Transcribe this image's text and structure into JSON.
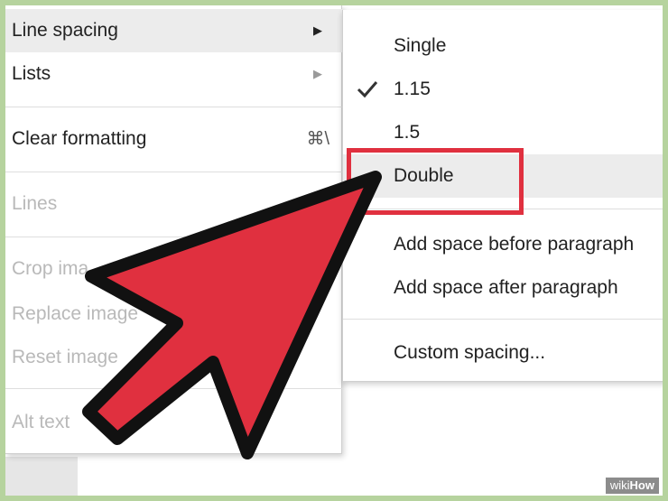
{
  "main_menu": {
    "items": [
      {
        "label": "Line spacing",
        "has_submenu": true
      },
      {
        "label": "Lists",
        "has_submenu": true
      },
      {
        "label": "Clear formatting",
        "shortcut": "⌘\\"
      },
      {
        "label": "Lines"
      },
      {
        "label": "Crop ima"
      },
      {
        "label": "Replace image"
      },
      {
        "label": "Reset image"
      },
      {
        "label": "Alt text"
      }
    ]
  },
  "submenu": {
    "items": [
      {
        "label": "Single"
      },
      {
        "label": "1.15",
        "checked": true
      },
      {
        "label": "1.5"
      },
      {
        "label": "Double",
        "highlighted": true
      },
      {
        "label": "Add space before paragraph"
      },
      {
        "label": "Add space after paragraph"
      },
      {
        "label": "Custom spacing..."
      }
    ]
  },
  "colors": {
    "highlight": "#e0303f",
    "pointer_fill": "#e0303f",
    "border": "#b6d39e"
  },
  "watermark": {
    "part1": "wiki",
    "part2": "How"
  },
  "icons": {
    "submenu_arrow": "triangle-right-icon",
    "checked": "checkmark-icon",
    "pointer": "arrow-cursor-icon"
  }
}
